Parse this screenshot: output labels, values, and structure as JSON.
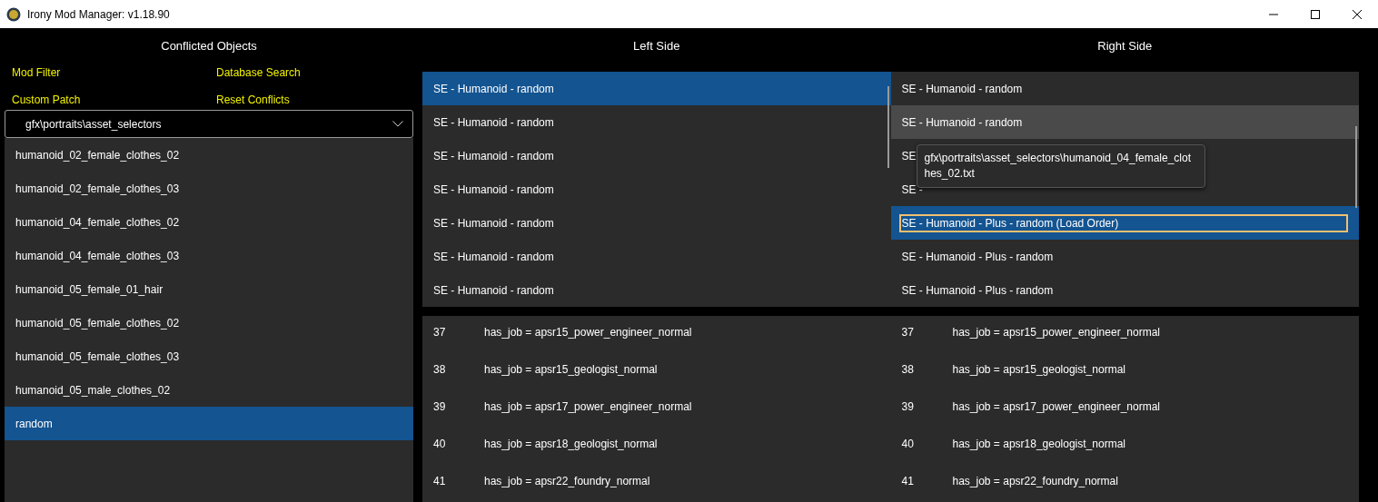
{
  "window": {
    "title": "Irony Mod Manager: v1.18.90"
  },
  "conflicts": {
    "header": "Conflicted Objects",
    "links": [
      {
        "label": "Mod Filter"
      },
      {
        "label": "Database Search"
      },
      {
        "label": "Custom Patch"
      },
      {
        "label": "Reset Conflicts"
      }
    ],
    "dropdown": {
      "value": "gfx\\portraits\\asset_selectors"
    },
    "items": [
      {
        "label": "humanoid_02_female_clothes_02",
        "selected": false
      },
      {
        "label": "humanoid_02_female_clothes_03",
        "selected": false
      },
      {
        "label": "humanoid_04_female_clothes_02",
        "selected": false
      },
      {
        "label": "humanoid_04_female_clothes_03",
        "selected": false
      },
      {
        "label": "humanoid_05_female_01_hair",
        "selected": false
      },
      {
        "label": "humanoid_05_female_clothes_02",
        "selected": false
      },
      {
        "label": "humanoid_05_female_clothes_03",
        "selected": false
      },
      {
        "label": "humanoid_05_male_clothes_02",
        "selected": false
      },
      {
        "label": "random",
        "selected": true
      }
    ]
  },
  "left_side": {
    "header": "Left Side",
    "mods": [
      {
        "label": "SE - Humanoid - random",
        "selected": true
      },
      {
        "label": "SE - Humanoid - random",
        "selected": false
      },
      {
        "label": "SE - Humanoid - random",
        "selected": false
      },
      {
        "label": "SE - Humanoid - random",
        "selected": false
      },
      {
        "label": "SE - Humanoid - random",
        "selected": false
      },
      {
        "label": "SE - Humanoid - random",
        "selected": false
      },
      {
        "label": "SE - Humanoid - random",
        "selected": false
      }
    ],
    "code": [
      {
        "line": "37",
        "text": "has_job = apsr15_power_engineer_normal"
      },
      {
        "line": "38",
        "text": "has_job = apsr15_geologist_normal"
      },
      {
        "line": "39",
        "text": "has_job = apsr17_power_engineer_normal"
      },
      {
        "line": "40",
        "text": "has_job = apsr18_geologist_normal"
      },
      {
        "line": "41",
        "text": "has_job = apsr22_foundry_normal"
      }
    ]
  },
  "right_side": {
    "header": "Right Side",
    "mods": [
      {
        "label": "SE - Humanoid - random",
        "selected": false,
        "hovered": false,
        "focused": false
      },
      {
        "label": "SE - Humanoid - random",
        "selected": false,
        "hovered": true,
        "focused": false
      },
      {
        "label": "SE",
        "selected": false,
        "hovered": false,
        "focused": false
      },
      {
        "label": "SE -",
        "selected": false,
        "hovered": false,
        "focused": false
      },
      {
        "label": "SE - Humanoid - Plus - random (Load Order)",
        "selected": true,
        "hovered": false,
        "focused": true
      },
      {
        "label": "SE - Humanoid - Plus - random",
        "selected": false,
        "hovered": false,
        "focused": false
      },
      {
        "label": "SE - Humanoid - Plus - random",
        "selected": false,
        "hovered": false,
        "focused": false
      }
    ],
    "tooltip": "gfx\\portraits\\asset_selectors\\humanoid_04_female_clothes_02.txt",
    "code": [
      {
        "line": "37",
        "text": "has_job = apsr15_power_engineer_normal"
      },
      {
        "line": "38",
        "text": "has_job = apsr15_geologist_normal"
      },
      {
        "line": "39",
        "text": "has_job = apsr17_power_engineer_normal"
      },
      {
        "line": "40",
        "text": "has_job = apsr18_geologist_normal"
      },
      {
        "line": "41",
        "text": "has_job = apsr22_foundry_normal"
      }
    ]
  }
}
